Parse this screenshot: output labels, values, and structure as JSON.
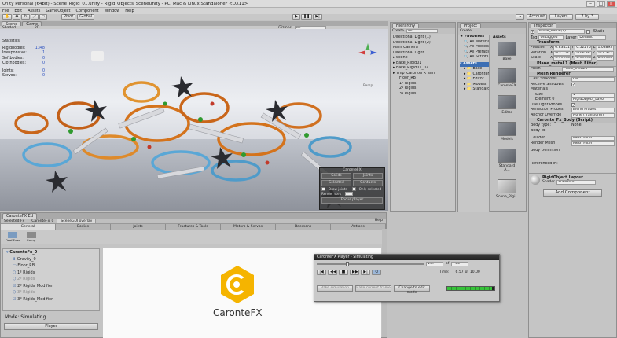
{
  "window": {
    "title": "Unity Personal (64bit) - Scene_Rigid_01.unity - Rigid_Objects_SceneUnity - PC, Mac & Linux Standalone* <DX11>"
  },
  "menu": [
    "File",
    "Edit",
    "Assets",
    "GameObject",
    "Component",
    "Window",
    "Help"
  ],
  "toolbar": {
    "pivot": "Pivot",
    "global": "Global",
    "account": "Account",
    "layers": "Layers",
    "layout": "2 by 3"
  },
  "scene": {
    "tabs": [
      "Scene",
      "Game"
    ],
    "shaded": "Shaded",
    "mode_2d": "2D",
    "gizmos": "Gizmos",
    "search": "All",
    "persp": "Persp",
    "stats_title": "Statistics:",
    "stats": [
      {
        "label": "Rigidbodies:",
        "value": "1348"
      },
      {
        "label": "Irresponsive:",
        "value": "1"
      },
      {
        "label": "Softbodies:",
        "value": "0"
      },
      {
        "label": "Clothbodies:",
        "value": "0"
      },
      {
        "label": "Joints:",
        "value": "0"
      },
      {
        "label": "Servos:",
        "value": "0"
      }
    ],
    "overlay": {
      "title": "CaronteFX",
      "solids": "Solids",
      "joints": "Joints",
      "r_selected": "Selected",
      "r_contacts": "Contacts",
      "draw_joints": "Draw joints",
      "only_selected": "Only selected",
      "render_step": "Render step :",
      "render_step_val": "1",
      "focus_player": "Focus player"
    }
  },
  "hierarchy": {
    "tab": "Hierarchy",
    "create": "Create",
    "search": "All",
    "items": [
      "Directional Light (1)",
      "Directional Light (2)",
      "Main Camera",
      "Directional Light",
      "Scene",
      "Bake_Rigid01",
      "Bake_Rigid01_02",
      "Tmp_CaronteFX_sim",
      "Floor_RB",
      "1º Rigids",
      "2º Rigids",
      "3º Rigids"
    ]
  },
  "project": {
    "tab": "Project",
    "create": "Create",
    "favorites": "Favorites",
    "fav_items": [
      "All Material",
      "All Models",
      "All Prefabs",
      "All Scripts"
    ],
    "assets_label": "Assets",
    "tree": [
      "Bake",
      "CaronteFX",
      "Editor",
      "Models",
      "Standard A"
    ],
    "grid": [
      "Bake",
      "CaronteFX",
      "Editor",
      "Models",
      "Standard A...",
      "Scene_Rigi..."
    ]
  },
  "inspector": {
    "tab": "Inspector",
    "object_name": "Plane_metal(1)",
    "static": "Static",
    "tag_label": "Tag",
    "tag": "Untagged",
    "layer_label": "Layer",
    "layer": "Default",
    "transform": "Transform",
    "position": {
      "label": "Position",
      "x": "0.83451",
      "y": "0.52275",
      "z": "1.03895"
    },
    "rotation": {
      "label": "Rotation",
      "x": "-43.558",
      "y": "-106.38",
      "z": "111.317"
    },
    "scale": {
      "label": "Scale",
      "x": "0.99993",
      "y": "0.99993",
      "z": "0.99993"
    },
    "mesh_filter": "Plane_metal 1 (Mesh Filter)",
    "mesh_label": "Mesh",
    "mesh_val": "Plane_metal1",
    "mesh_renderer": "Mesh Renderer",
    "cast_shadows": "Cast Shadows",
    "cast_val": "On",
    "receive_shadows": "Receive Shadows",
    "materials": "Materials",
    "size": "Size",
    "size_val": "1",
    "element0": "Element 0",
    "element0_val": "RigidObject_Layo",
    "light_probes": "Use Light Probes",
    "reflection_probes": "Reflection Probes",
    "reflection_val": "Blend Probes",
    "anchor": "Anchor Override",
    "anchor_val": "None (Transform)",
    "caronte_body": "Caronte_Fx_Body (Script)",
    "body_type": "Body type:",
    "body_type_val": "None",
    "body_id": "Body id:",
    "collider": "Collider",
    "collider_val": "Mesh Filter",
    "render_mesh": "Render Mesh",
    "render_mesh_val": "Mesh Filter",
    "body_definition": "Body Definition:",
    "referenced": "Referenced in:",
    "material_name": "RigidObject_Layout",
    "shader": "Shader",
    "shader_val": "Standard",
    "add_component": "Add Component"
  },
  "cfx": {
    "window_tab": "CaronteFX Ed",
    "subtabs": [
      "Selected Fx",
      "CaronteFx_0",
      "SceneGUI overlay"
    ],
    "help": "Help",
    "tabs": [
      "General",
      "Bodies",
      "Joints",
      "Fractures & Tools",
      "Motors & Servos",
      "Daemons",
      "Actions"
    ],
    "icons": [
      "Dsef Fxas",
      "Group"
    ],
    "tree": [
      "CaronteFx_0",
      "Gravity_0",
      "Floor_RB",
      "1º Rigids",
      "2º Rigids",
      "2º Rigids_Modifier",
      "3º Rigids",
      "3º Rigids_Modifier"
    ],
    "mode": "Mode: Simulating...",
    "player_btn": "Player",
    "logo": "CaronteFX"
  },
  "player": {
    "title": "CaronteFX Player - Simulating",
    "frame": "197",
    "of": "of",
    "total": "700",
    "time_label": "Time:",
    "time": "6.57",
    "time_of": "of",
    "time_total": "10.00",
    "bake": "Bake simulation",
    "bake_current": "Bake current frame",
    "change_mode": "Change to edit mode",
    "progress": 0.95
  },
  "colors": {
    "accent": "#f5b400",
    "stat_value": "#2a4fbf",
    "selection": "#3d6fb4",
    "progress": "#37c23a"
  }
}
